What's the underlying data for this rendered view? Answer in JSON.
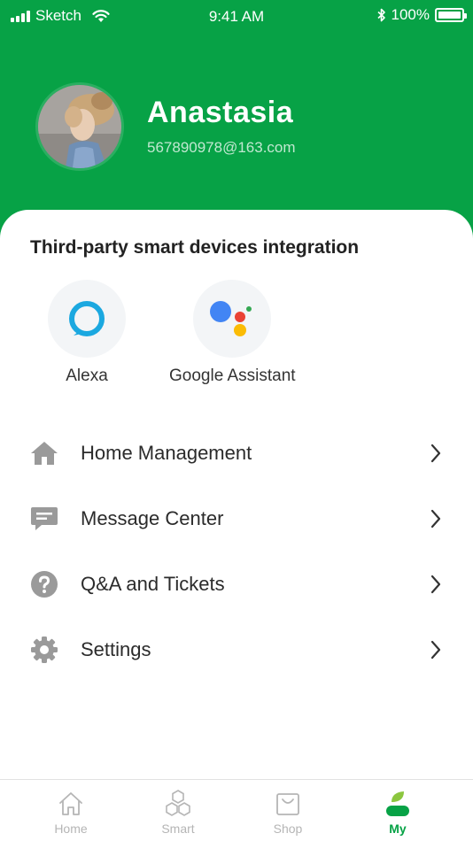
{
  "status_bar": {
    "carrier": "Sketch",
    "time": "9:41 AM",
    "battery": "100%"
  },
  "profile": {
    "name": "Anastasia",
    "email": "567890978@163.com"
  },
  "integration": {
    "title": "Third-party smart devices integration",
    "items": [
      {
        "label": "Alexa",
        "icon": "alexa-icon"
      },
      {
        "label": "Google Assistant",
        "icon": "google-assistant-icon"
      }
    ]
  },
  "menu": [
    {
      "label": "Home Management",
      "icon": "home-icon"
    },
    {
      "label": "Message Center",
      "icon": "message-icon"
    },
    {
      "label": "Q&A and Tickets",
      "icon": "question-icon"
    },
    {
      "label": "Settings",
      "icon": "gear-icon"
    }
  ],
  "tabs": [
    {
      "label": "Home",
      "icon": "home-outline-icon",
      "active": false
    },
    {
      "label": "Smart",
      "icon": "hexagons-icon",
      "active": false
    },
    {
      "label": "Shop",
      "icon": "shopping-bag-icon",
      "active": false
    },
    {
      "label": "My",
      "icon": "profile-icon",
      "active": true
    }
  ],
  "colors": {
    "brand_green": "#07A246",
    "alexa_blue": "#1BA8E0",
    "google_blue": "#4285F4",
    "google_red": "#EA4335",
    "google_yellow": "#FBBC05",
    "google_green": "#34A853"
  }
}
